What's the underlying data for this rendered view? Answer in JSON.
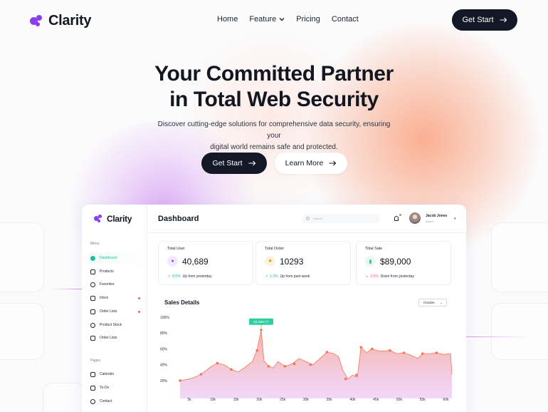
{
  "brand": {
    "name": "Clarity",
    "accent": "#8b3ff0"
  },
  "nav": {
    "links": [
      "Home",
      "Feature",
      "Pricing",
      "Contact"
    ],
    "cta": "Get Start"
  },
  "hero": {
    "title_line1": "Your Committed Partner",
    "title_line2": "in Total Web Security",
    "subtitle_line1": "Discover cutting-edge solutions for comprehensive data security, ensuring your",
    "subtitle_line2": "digital world remains safe and protected.",
    "primary_cta": "Get Start",
    "secondary_cta": "Learn More"
  },
  "dashboard": {
    "brand": "Clarity",
    "title": "Dashboard",
    "search_placeholder": "Search",
    "user": {
      "name": "Jacob Jones",
      "role": "Admin"
    },
    "menu_label": "Menu",
    "menu": [
      "Dashboard",
      "Products",
      "Favorites",
      "Inbox",
      "Order Lists",
      "Product Stock",
      "Order Lists"
    ],
    "pages_label": "Pages",
    "pages": [
      "Calender",
      "To-Do",
      "Contact"
    ],
    "cards": [
      {
        "label": "Total User",
        "value": "40,689",
        "trend_pct": "8.5%",
        "trend_text": "Up from yesterday",
        "trend_color": "#18c29c",
        "icon": "users-icon"
      },
      {
        "label": "Total Order",
        "value": "10293",
        "trend_pct": "1.3%",
        "trend_text": "Up from past week",
        "trend_color": "#18c29c",
        "icon": "box-icon"
      },
      {
        "label": "Total Sale",
        "value": "$89,000",
        "trend_pct": "2.5%",
        "trend_text": "Down from yesterday",
        "trend_color": "#f06464",
        "icon": "bar-chart-icon"
      }
    ],
    "sales_title": "Sales Details",
    "month": "October"
  },
  "chart_data": {
    "type": "area",
    "title": "Sales Details",
    "x_ticks": [
      "5k",
      "10k",
      "15k",
      "20k",
      "25k",
      "30k",
      "35k",
      "40k",
      "45k",
      "50k",
      "55k",
      "60k"
    ],
    "y_ticks": [
      "20%",
      "40%",
      "60%",
      "80%",
      "100%"
    ],
    "ylim": [
      10,
      100
    ],
    "xlim": [
      3,
      61
    ],
    "tooltip": {
      "x": 20.4,
      "y": 84,
      "label": "64,3664.77"
    },
    "values": [
      [
        3,
        20
      ],
      [
        5,
        22
      ],
      [
        6.5,
        25
      ],
      [
        8,
        30
      ],
      [
        9.5,
        37
      ],
      [
        11,
        42
      ],
      [
        12.5,
        40
      ],
      [
        14,
        34
      ],
      [
        15.5,
        31
      ],
      [
        17,
        37
      ],
      [
        18.5,
        44
      ],
      [
        19.5,
        58
      ],
      [
        20.4,
        84
      ],
      [
        21,
        45
      ],
      [
        22,
        38
      ],
      [
        23,
        36
      ],
      [
        24,
        44
      ],
      [
        25.5,
        38
      ],
      [
        27,
        41
      ],
      [
        28.5,
        48
      ],
      [
        30,
        44
      ],
      [
        31.5,
        40
      ],
      [
        33,
        48
      ],
      [
        34.5,
        56
      ],
      [
        36,
        54
      ],
      [
        37,
        50
      ],
      [
        38,
        32
      ],
      [
        39,
        22
      ],
      [
        40,
        27
      ],
      [
        41,
        24
      ],
      [
        41.8,
        62
      ],
      [
        43,
        55
      ],
      [
        44,
        60
      ],
      [
        46,
        57
      ],
      [
        48,
        58
      ],
      [
        49.5,
        54
      ],
      [
        51,
        55
      ],
      [
        52.5,
        52
      ],
      [
        54,
        48
      ],
      [
        55,
        54
      ],
      [
        56.5,
        54
      ],
      [
        58,
        55
      ],
      [
        59.5,
        53
      ],
      [
        61,
        54
      ],
      [
        61.3,
        28
      ]
    ],
    "markers": [
      [
        3,
        20
      ],
      [
        7.5,
        28
      ],
      [
        11,
        42
      ],
      [
        14,
        34
      ],
      [
        19.5,
        58
      ],
      [
        20.4,
        84
      ],
      [
        22,
        38
      ],
      [
        25.5,
        38
      ],
      [
        27.5,
        41
      ],
      [
        31,
        40
      ],
      [
        34.5,
        56
      ],
      [
        38.5,
        22
      ],
      [
        40.8,
        27
      ],
      [
        41.8,
        62
      ],
      [
        44.2,
        60
      ],
      [
        48,
        58
      ],
      [
        51,
        55
      ],
      [
        55,
        54
      ],
      [
        58,
        55
      ]
    ],
    "colors": {
      "line": "#f2765a",
      "fill_top": "#f8a48c",
      "fill_bottom": "#e6b8f6",
      "tooltip": "#2ecf9f"
    }
  }
}
